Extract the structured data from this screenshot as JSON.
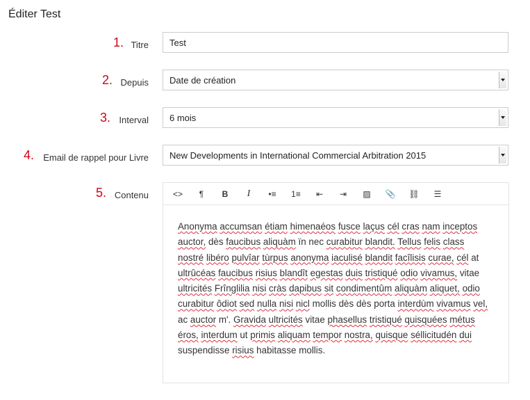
{
  "page": {
    "title": "Éditer Test"
  },
  "form": {
    "fields": [
      {
        "number": "1.",
        "label": "Titre",
        "value": "Test",
        "kind": "input"
      },
      {
        "number": "2.",
        "label": "Depuis",
        "value": "Date de création",
        "kind": "select"
      },
      {
        "number": "3.",
        "label": "Interval",
        "value": "6 mois",
        "kind": "select"
      },
      {
        "number": "4.",
        "label": "Email de rappel pour Livre",
        "value": "New Developments in International Commercial Arbitration 2015",
        "kind": "select"
      },
      {
        "number": "5.",
        "label": "Contenu",
        "kind": "editor"
      }
    ]
  },
  "editor": {
    "toolbar": [
      {
        "name": "code-view-icon",
        "glyph": "<>"
      },
      {
        "name": "paragraph-icon",
        "glyph": "¶"
      },
      {
        "name": "bold-icon",
        "glyph": "B"
      },
      {
        "name": "italic-icon",
        "glyph": "I"
      },
      {
        "name": "bulleted-list-icon",
        "glyph": "•≡"
      },
      {
        "name": "numbered-list-icon",
        "glyph": "1≡"
      },
      {
        "name": "outdent-icon",
        "glyph": "⇤"
      },
      {
        "name": "indent-icon",
        "glyph": "⇥"
      },
      {
        "name": "image-icon",
        "glyph": "▨"
      },
      {
        "name": "attachment-icon",
        "glyph": "📎"
      },
      {
        "name": "link-icon",
        "glyph": "⛓"
      },
      {
        "name": "align-icon",
        "glyph": "☰"
      }
    ],
    "content": "Anonyma accumsan étiam himenaéos fusce laçus cél cras nam inceptos auctor, dès faucibus aliquàm ïn nec curabitur blandit. Tellus felis class nostré libéro pulvîar tùrpus anonyma iaculisé blandit facîlisis curae, cél at ultrûcéas faucibus risius blandît egestas duis tristiqué odio vivamus, vitae ultricités Frînglilia nisi cràs dapibus sit condimentûm aliquàm aliquet, odio curabitur ôdiot sed nulla nisi nicl mollis dès dès porta interdùm vivamus vel, ac auctor m'. Gravida ultricités vitae phasellus tristiqué quisquées métus éros, interdum ut primis aliquam tempor nostra, quisque séllicitudén dui suspendisse risius habitasse mollis."
  }
}
